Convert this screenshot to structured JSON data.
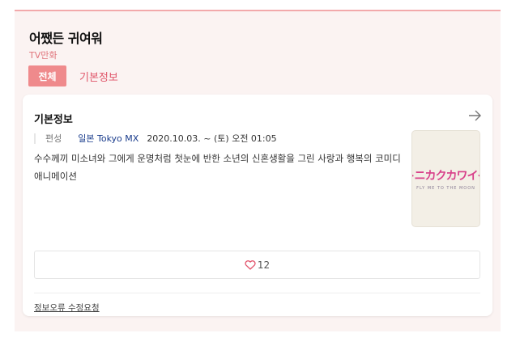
{
  "header": {
    "title": "어쨌든 귀여워",
    "subtitle": "TV만화"
  },
  "tabs": [
    {
      "label": "전체",
      "active": true
    },
    {
      "label": "기본정보",
      "active": false
    }
  ],
  "card": {
    "title": "기본정보",
    "info": {
      "label": "편성",
      "broadcaster": "일본 Tokyo MX",
      "date": "2020.10.03. ~ (토) 오전 01:05"
    },
    "description": "수수께끼 미소녀와 그에게 운명처럼 첫눈에 반한 소년의 신혼생활을 그린 사랑과 행복의 코미디 애니메이션",
    "poster": {
      "title_text": "トニカクカワイイ",
      "sub_text": "FLY ME TO THE MOON"
    },
    "like_count": "12",
    "report_link": "정보오류 수정요청"
  },
  "colors": {
    "accent": "#ef8a8c",
    "panel_bg": "#fbf3f2",
    "link": "#1a3c8c",
    "heart": "#e2536b"
  }
}
